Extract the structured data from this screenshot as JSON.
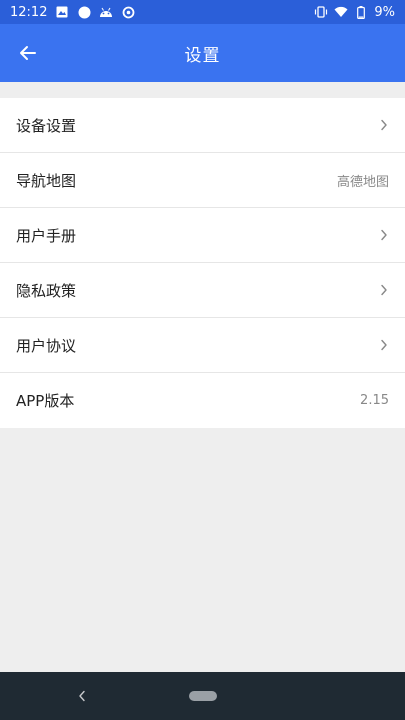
{
  "status_bar": {
    "time": "12:12",
    "battery": "9%",
    "left_icons": [
      "image-icon",
      "circle-notification-icon",
      "android-icon",
      "sync-icon"
    ],
    "right_icons": [
      "vibrate-icon",
      "wifi-icon",
      "battery-icon"
    ]
  },
  "app_bar": {
    "title": "设置",
    "back_icon": "arrow-left-icon"
  },
  "settings": {
    "items": [
      {
        "label": "设备设置",
        "value": "",
        "has_chevron": true
      },
      {
        "label": "导航地图",
        "value": "高德地图",
        "has_chevron": false
      },
      {
        "label": "用户手册",
        "value": "",
        "has_chevron": true
      },
      {
        "label": "隐私政策",
        "value": "",
        "has_chevron": true
      },
      {
        "label": "用户协议",
        "value": "",
        "has_chevron": true
      },
      {
        "label": "APP版本",
        "value": "2.15",
        "has_chevron": false
      }
    ]
  },
  "nav_bar": {
    "back_icon": "chevron-left-icon",
    "home_icon": "home-pill-icon"
  },
  "colors": {
    "status_bar": "#2b5fd9",
    "app_bar": "#3a73f0",
    "background": "#eeeeee",
    "nav_bar": "#1f2a33"
  }
}
